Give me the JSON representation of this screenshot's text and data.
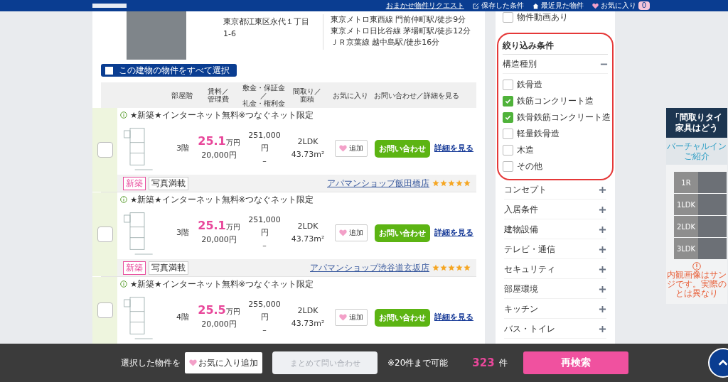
{
  "top_nav": {
    "links": [
      {
        "label": "おまかせ物件リクエスト",
        "kind": "link"
      },
      {
        "label": "保存した条件",
        "kind": "saved"
      },
      {
        "label": "最近見た物件",
        "kind": "recent"
      },
      {
        "label": "お気に入り",
        "kind": "favorite"
      }
    ],
    "favorite_count": "0"
  },
  "building": {
    "address": [
      "東京都江東区永代１丁目",
      "1-6"
    ],
    "stations": [
      "東京メトロ東西線 門前仲町駅/徒歩9分",
      "東京メトロ日比谷線 茅場町駅/徒歩12分",
      "ＪＲ京葉線 越中島駅/徒歩16分"
    ]
  },
  "select_all": "この建物の物件をすべて選択",
  "columns": [
    [
      "部屋階"
    ],
    [
      "賃料／",
      "管理費"
    ],
    [
      "敷金・保証金",
      "／",
      "礼金・権利金"
    ],
    [
      "間取り／",
      "面積"
    ],
    [
      "お気に入り"
    ],
    [
      "お問い合わせ／詳細を見る"
    ]
  ],
  "listings": [
    {
      "checked": false,
      "note": "★新築★インターネット無料※つなぐネット限定",
      "floor": "3階",
      "rent": "25.1",
      "rent_unit": "万円",
      "fee": "20,000円",
      "deposit": [
        "251,000",
        "円"
      ],
      "key_money": "–",
      "layout": "2LDK",
      "area": "43.73m²",
      "favorite": "追加",
      "inquiry": "お問い合わせ",
      "details": "詳細を見る",
      "tags": [
        {
          "label": "新築",
          "kind": "new"
        },
        {
          "label": "写真満載",
          "kind": "plain"
        }
      ],
      "shop": "アパマンショップ飯田橋店",
      "stars": 5
    },
    {
      "checked": false,
      "note": "★新築★インターネット無料※つなぐネット限定",
      "floor": "3階",
      "rent": "25.1",
      "rent_unit": "万円",
      "fee": "20,000円",
      "deposit": [
        "251,000",
        "円"
      ],
      "key_money": "–",
      "layout": "2LDK",
      "area": "43.73m²",
      "favorite": "追加",
      "inquiry": "お問い合わせ",
      "details": "詳細を見る",
      "tags": [
        {
          "label": "新築",
          "kind": "new"
        },
        {
          "label": "写真満載",
          "kind": "plain"
        }
      ],
      "shop": "アパマンショップ渋谷道玄坂店",
      "stars": 5
    },
    {
      "checked": false,
      "note": "★新築★インターネット無料※つなぐネット限定",
      "floor": "4階",
      "rent": "25.5",
      "rent_unit": "万円",
      "fee": "20,000円",
      "deposit": [
        "255,000",
        "円"
      ],
      "key_money": "–",
      "layout": "2LDK",
      "area": "43.73m²",
      "favorite": "追加",
      "inquiry": "お問い合わせ",
      "details": "詳細を見る"
    }
  ],
  "sidebar": {
    "video_option": {
      "label": "物件動画あり",
      "checked": false
    },
    "filter_title": "絞り込み条件",
    "sections": [
      {
        "label": "構造種別",
        "expanded": true,
        "options": [
          {
            "label": "鉄骨造",
            "checked": false
          },
          {
            "label": "鉄筋コンクリート造",
            "checked": true
          },
          {
            "label": "鉄骨鉄筋コンクリート造",
            "checked": true
          },
          {
            "label": "軽量鉄骨造",
            "checked": false
          },
          {
            "label": "木造",
            "checked": false
          },
          {
            "label": "その他",
            "checked": false
          }
        ]
      },
      {
        "label": "コンセプト",
        "expanded": false
      },
      {
        "label": "入居条件",
        "expanded": false
      },
      {
        "label": "建物設備",
        "expanded": false
      },
      {
        "label": "テレビ・通信",
        "expanded": false
      },
      {
        "label": "セキュリティ",
        "expanded": false
      },
      {
        "label": "部屋環境",
        "expanded": false
      },
      {
        "label": "キッチン",
        "expanded": false
      },
      {
        "label": "バス・トイレ",
        "expanded": false
      }
    ]
  },
  "ad": {
    "title": [
      "「間取りタイ",
      "家具はどう"
    ],
    "subtitle": [
      "バーチャルイン",
      "ご紹介"
    ],
    "tiles": [
      "1R",
      "1LDK",
      "2LDK",
      "3LDK"
    ],
    "warning": [
      "内観画像はサン",
      "ジです。実際の",
      "とは異なり"
    ]
  },
  "bottom_bar": {
    "label": "選択した物件を",
    "favorite": "お気に入り追加",
    "bulk_inquiry": {
      "label": "まとめて問い合わせ",
      "disabled": true
    },
    "note": "※20件まで可能",
    "count": "323",
    "count_unit": "件",
    "search": "再検索"
  }
}
